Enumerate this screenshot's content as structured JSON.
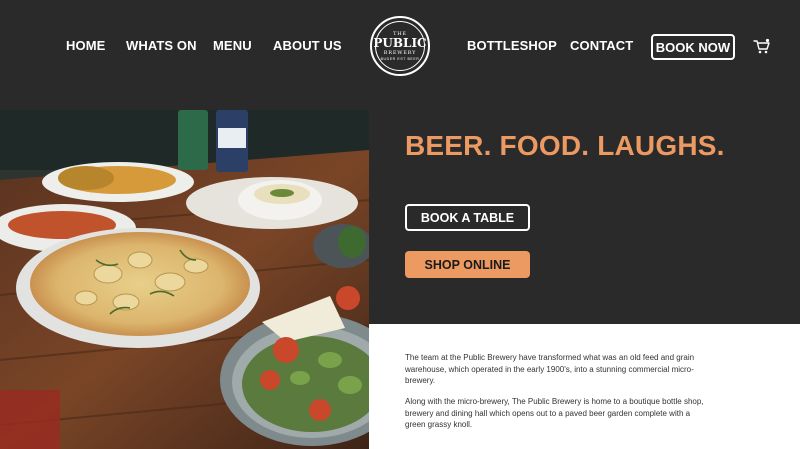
{
  "nav": {
    "home": "HOME",
    "whats_on": "WHATS ON",
    "menu": "MENU",
    "about_us": "ABOUT US",
    "bottleshop": "BOTTLESHOP",
    "contact": "CONTACT",
    "book_now": "BOOK NOW",
    "cart_icon": "cart-icon"
  },
  "logo": {
    "top": "THE",
    "line1": "PUBLIC",
    "bottom": "BREWERY",
    "tagline": "BUDER EST BEER"
  },
  "hero": {
    "headline": "BEER. FOOD. LAUGHS.",
    "book_table": "BOOK A TABLE",
    "shop_online": "SHOP ONLINE"
  },
  "about": {
    "para1": "The team at the Public Brewery have transformed what was an old feed and grain warehouse, which operated in the early 1900's, into a stunning commercial micro-brewery.",
    "para2": "Along with the micro-brewery, The Public Brewery is home to a boutique bottle shop, brewery and dining hall which opens out to a paved beer garden complete with a green grassy knoll."
  },
  "colors": {
    "accent": "#ec9a62",
    "dark": "#2a2a2a",
    "light": "#ffffff"
  }
}
